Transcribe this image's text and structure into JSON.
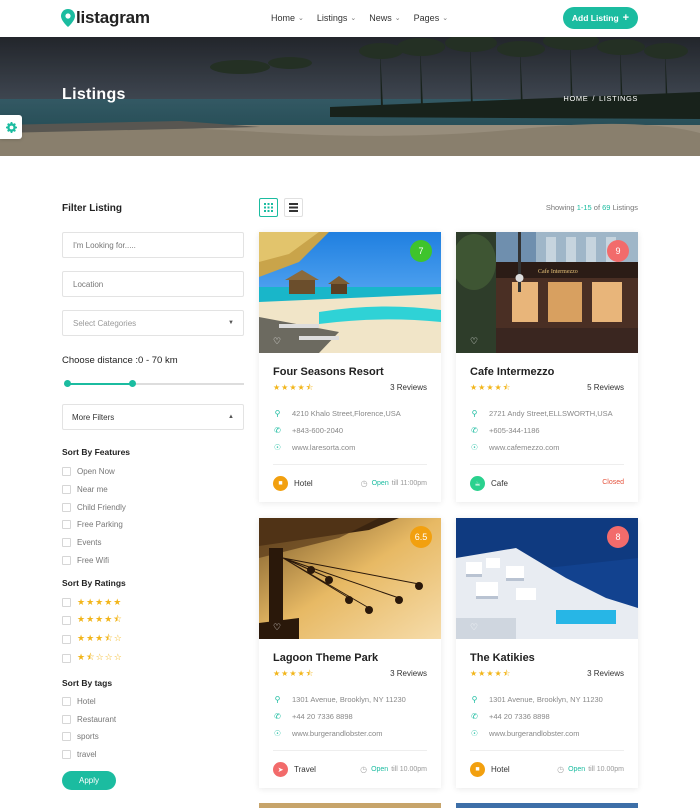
{
  "brand": {
    "name": "listagram",
    "accent": "#1bbca0"
  },
  "nav": {
    "items": [
      {
        "label": "Home",
        "icon": "chevron-down-icon"
      },
      {
        "label": "Listings",
        "icon": "chevron-down-icon"
      },
      {
        "label": "News",
        "icon": "chevron-down-icon"
      },
      {
        "label": "Pages",
        "icon": "chevron-down-icon"
      }
    ],
    "add_button": "Add Listing",
    "add_icon": "+"
  },
  "hero": {
    "title": "Listings",
    "breadcrumb": [
      "HOME",
      "LISTINGS"
    ],
    "breadcrumb_sep": "/"
  },
  "sidebar": {
    "title": "Filter Listing",
    "search_placeholder": "I'm Looking for.....",
    "location_placeholder": "Location",
    "category_placeholder": "Select Categories",
    "distance_label": "Choose distance :0 - 70 km",
    "distance_range": {
      "min": 0,
      "max": 70,
      "low_fraction": 0.0,
      "high_fraction": 0.36
    },
    "more_filters": "More Filters",
    "features_title": "Sort By Features",
    "features": [
      "Open Now",
      "Near me",
      "Child Friendly",
      "Free Parking",
      "Events",
      "Free Wifi"
    ],
    "ratings_title": "Sort By Ratings",
    "ratings": [
      {
        "stars": "★★★★★",
        "value": 5
      },
      {
        "stars": "★★★★⯪",
        "value": 4.5
      },
      {
        "stars": "★★★⯪☆",
        "value": 3.5
      },
      {
        "stars": "★⯪☆☆☆",
        "value": 1.5
      }
    ],
    "tags_title": "Sort By tags",
    "tags": [
      "Hotel",
      "Restaurant",
      "sports",
      "travel"
    ],
    "apply": "Apply"
  },
  "results": {
    "showing_prefix": "Showing ",
    "range": "1-15",
    "of": " of ",
    "total": "69",
    "suffix": " Listings"
  },
  "listings": [
    {
      "badge": "7",
      "badge_color": "#3fc42c",
      "title": "Four Seasons Resort",
      "stars": "★★★★⯪",
      "reviews": "3 Reviews",
      "address": "4210 Khalo Street,Florence,USA",
      "phone": "+843-600-2040",
      "website": "www.laresorta.com",
      "category": "Hotel",
      "category_color": "#f2a00f",
      "category_icon": "hotel-icon",
      "status": "open",
      "open_label": "Open",
      "hours": "till 11:00pm"
    },
    {
      "badge": "9",
      "badge_color": "#f26b6b",
      "title": "Cafe Intermezzo",
      "stars": "★★★★⯪",
      "reviews": "5 Reviews",
      "address": "2721 Andy Street,ELLSWORTH,USA",
      "phone": "+605-344-1186",
      "website": "www.cafemezzo.com",
      "category": "Cafe",
      "category_color": "#2ad18e",
      "category_icon": "cafe-icon",
      "status": "closed",
      "closed_label": "Closed"
    },
    {
      "badge": "6.5",
      "badge_color": "#f2a00f",
      "title": "Lagoon Theme Park",
      "stars": "★★★★⯪",
      "reviews": "3 Reviews",
      "address": "1301 Avenue, Brooklyn, NY 11230",
      "phone": "+44 20 7336 8898",
      "website": "www.burgerandlobster.com",
      "category": "Travel",
      "category_color": "#f26b6b",
      "category_icon": "travel-icon",
      "status": "open",
      "open_label": "Open",
      "hours": "till 10.00pm"
    },
    {
      "badge": "8",
      "badge_color": "#f26b6b",
      "title": "The Katikies",
      "stars": "★★★★⯪",
      "reviews": "3 Reviews",
      "address": "1301 Avenue, Brooklyn, NY 11230",
      "phone": "+44 20 7336 8898",
      "website": "www.burgerandlobster.com",
      "category": "Hotel",
      "category_color": "#f2a00f",
      "category_icon": "hotel-icon",
      "status": "open",
      "open_label": "Open",
      "hours": "till 10.00pm"
    }
  ]
}
